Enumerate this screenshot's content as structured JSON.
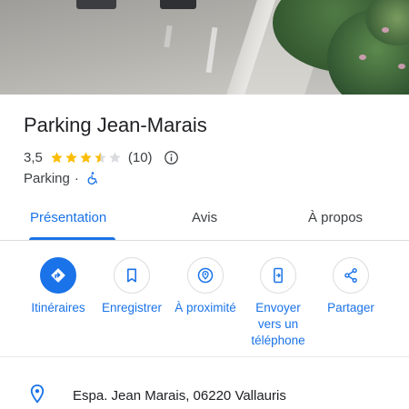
{
  "place": {
    "name": "Parking Jean-Marais",
    "rating": "3,5",
    "stars": 3.5,
    "review_count": "(10)",
    "category": "Parking",
    "separator": "·"
  },
  "tabs": [
    {
      "label": "Présentation",
      "active": true
    },
    {
      "label": "Avis",
      "active": false
    },
    {
      "label": "À propos",
      "active": false
    }
  ],
  "actions": [
    {
      "label": "Itinéraires",
      "icon": "directions-icon"
    },
    {
      "label": "Enregistrer",
      "icon": "bookmark-icon"
    },
    {
      "label": "À proximité",
      "icon": "nearby-icon"
    },
    {
      "label": "Envoyer vers un téléphone",
      "icon": "send-to-phone-icon"
    },
    {
      "label": "Partager",
      "icon": "share-icon"
    }
  ],
  "address": "Espa. Jean Marais, 06220 Vallauris",
  "colors": {
    "accent": "#1a73e8",
    "star": "#fbbc04",
    "star_empty": "#dadce0",
    "text": "#202124",
    "secondary_text": "#3c4043"
  }
}
